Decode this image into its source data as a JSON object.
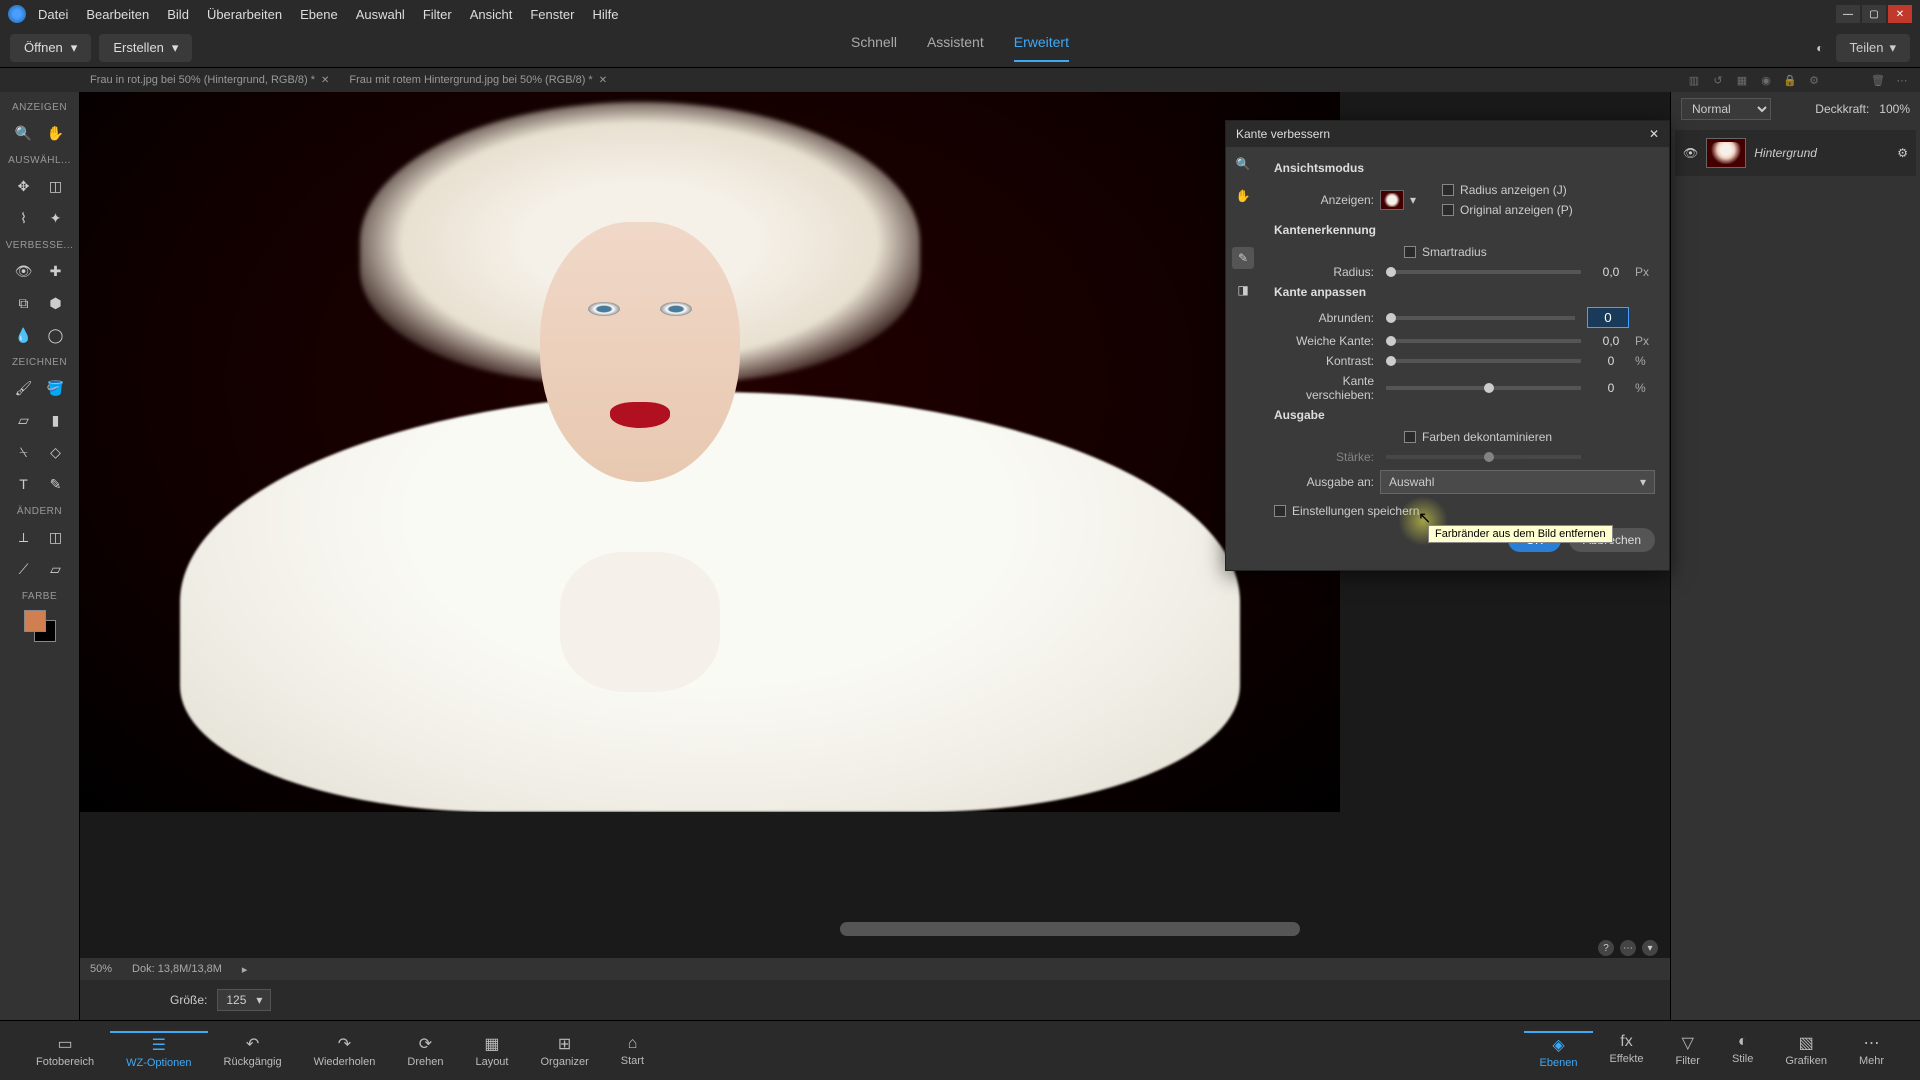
{
  "menu": {
    "items": [
      "Datei",
      "Bearbeiten",
      "Bild",
      "Überarbeiten",
      "Ebene",
      "Auswahl",
      "Filter",
      "Ansicht",
      "Fenster",
      "Hilfe"
    ]
  },
  "toolbar": {
    "open": "Öffnen",
    "create": "Erstellen",
    "modes": [
      "Schnell",
      "Assistent",
      "Erweitert"
    ],
    "share": "Teilen"
  },
  "doc_tabs": [
    "Frau in rot.jpg bei 50% (Hintergrund, RGB/8) *",
    "Frau mit rotem Hintergrund.jpg bei 50% (RGB/8) *"
  ],
  "toolbox": {
    "sections": [
      "ANZEIGEN",
      "AUSWÄHL...",
      "VERBESSE...",
      "ZEICHNEN",
      "ÄNDERN",
      "FARBE"
    ]
  },
  "canvas_status": {
    "zoom": "50%",
    "doc": "Dok: 13,8M/13,8M"
  },
  "options": {
    "size_label": "Größe:",
    "size_value": "125"
  },
  "right_panel": {
    "blend": "Normal",
    "opacity_label": "Deckkraft:",
    "opacity_value": "100%",
    "layer_name": "Hintergrund"
  },
  "dialog": {
    "title": "Kante verbessern",
    "sections": {
      "view": "Ansichtsmodus",
      "edge_detect": "Kantenerkennung",
      "adjust": "Kante anpassen",
      "output": "Ausgabe"
    },
    "view": {
      "label": "Anzeigen:",
      "show_radius": "Radius anzeigen (J)",
      "show_original": "Original anzeigen (P)"
    },
    "edge_detect": {
      "smart": "Smartradius",
      "radius_label": "Radius:",
      "radius_value": "0,0",
      "radius_unit": "Px"
    },
    "adjust": {
      "smooth_label": "Abrunden:",
      "smooth_value": "0",
      "feather_label": "Weiche Kante:",
      "feather_value": "0,0",
      "feather_unit": "Px",
      "contrast_label": "Kontrast:",
      "contrast_value": "0",
      "contrast_unit": "%",
      "shift_label": "Kante verschieben:",
      "shift_value": "0",
      "shift_unit": "%"
    },
    "output": {
      "decon": "Farben dekontaminieren",
      "tooltip": "Farbränder aus dem Bild entfernen",
      "amount_label": "Stärke:",
      "to_label": "Ausgabe an:",
      "to_value": "Auswahl"
    },
    "remember": "Einstellungen speichern",
    "ok": "OK",
    "cancel": "Abbrechen"
  },
  "bottom": {
    "left": [
      "Fotobereich",
      "WZ-Optionen",
      "Rückgängig",
      "Wiederholen",
      "Drehen",
      "Layout",
      "Organizer",
      "Start"
    ],
    "right": [
      "Ebenen",
      "Effekte",
      "Filter",
      "Stile",
      "Grafiken",
      "Mehr"
    ]
  }
}
